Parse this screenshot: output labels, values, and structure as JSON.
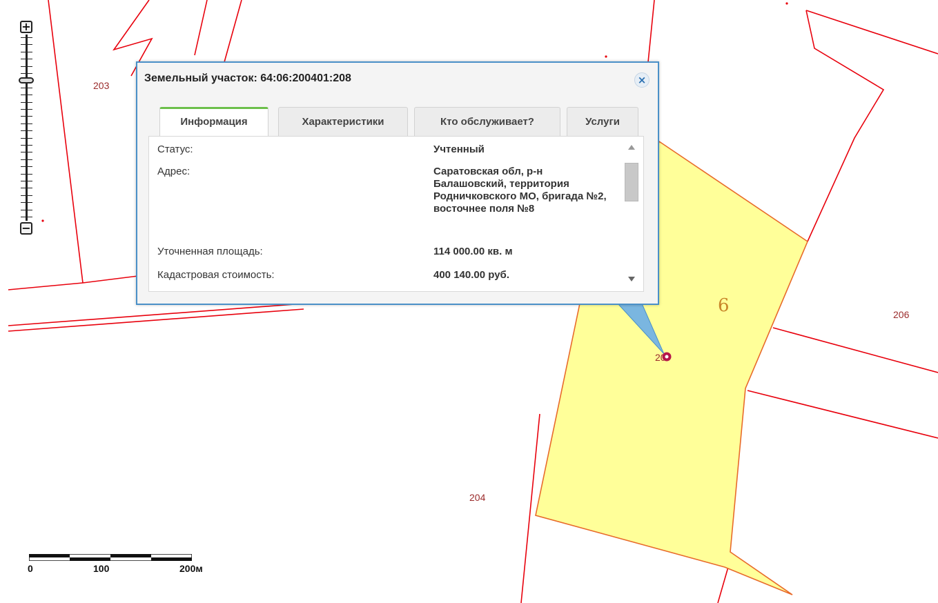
{
  "map": {
    "plot_labels": {
      "p203": "203",
      "p204": "204",
      "p206": "206",
      "p6": "6",
      "p208": "20"
    },
    "colors": {
      "boundary": "#e8000c",
      "selected_fill": "#ffff99",
      "selected_stroke": "#e86a2a",
      "label": "#9b2c2c"
    }
  },
  "zoom": {
    "in_label": "+",
    "out_label": "−",
    "in_icon": "plus-icon",
    "out_icon": "minus-icon"
  },
  "scale": {
    "labels": [
      "0",
      "100",
      "200м"
    ]
  },
  "popup": {
    "title": "Земельный участок: 64:06:200401:208",
    "close_icon": "close-icon",
    "close_label": "×",
    "tabs": [
      {
        "label": "Информация",
        "active": true
      },
      {
        "label": "Характеристики",
        "active": false
      },
      {
        "label": "Кто обслуживает?",
        "active": false
      },
      {
        "label": "Услуги",
        "active": false
      }
    ],
    "rows": [
      {
        "label": "Статус:",
        "value": "Учтенный"
      },
      {
        "label": "Адрес:",
        "value": "Саратовская обл, р-н Балашовский, территория Родничковского МО, бригада №2, восточнее поля №8"
      },
      {
        "label": "Уточненная площадь:",
        "value": "114 000.00 кв. м"
      },
      {
        "label": "Кадастровая стоимость:",
        "value": "400 140.00 руб."
      }
    ]
  }
}
